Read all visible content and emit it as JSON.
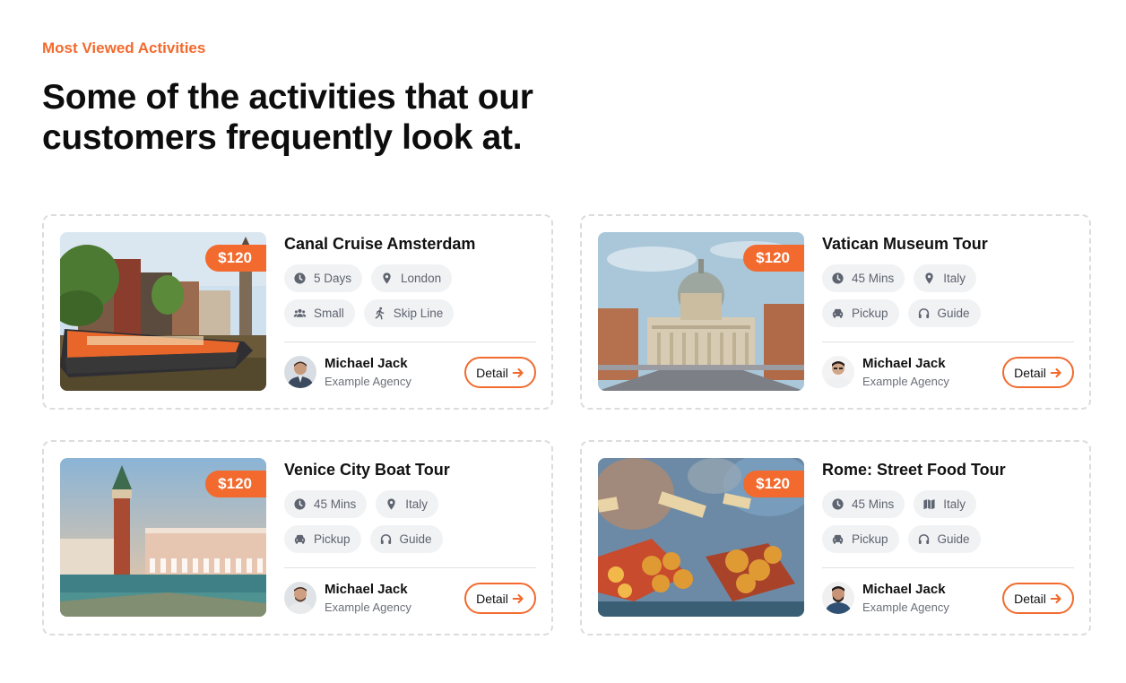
{
  "section": {
    "eyebrow": "Most Viewed Activities",
    "headline": "Some of the activities that our customers frequently look at."
  },
  "accent_color": "#f26a2e",
  "cards": [
    {
      "title": "Canal Cruise Amsterdam",
      "price": "$120",
      "chips": [
        {
          "icon": "clock-icon",
          "label": "5 Days"
        },
        {
          "icon": "location-pin-icon",
          "label": "London"
        },
        {
          "icon": "group-icon",
          "label": "Small"
        },
        {
          "icon": "walking-person-icon",
          "label": "Skip Line"
        }
      ],
      "agent": {
        "name": "Michael Jack",
        "agency": "Example Agency"
      },
      "detail_label": "Detail"
    },
    {
      "title": "Vatican Museum Tour",
      "price": "$120",
      "chips": [
        {
          "icon": "clock-icon",
          "label": "45 Mins"
        },
        {
          "icon": "location-pin-icon",
          "label": "Italy"
        },
        {
          "icon": "car-icon",
          "label": "Pickup"
        },
        {
          "icon": "headphones-icon",
          "label": "Guide"
        }
      ],
      "agent": {
        "name": "Michael Jack",
        "agency": "Example Agency"
      },
      "detail_label": "Detail"
    },
    {
      "title": "Venice City Boat Tour",
      "price": "$120",
      "chips": [
        {
          "icon": "clock-icon",
          "label": "45 Mins"
        },
        {
          "icon": "location-pin-icon",
          "label": "Italy"
        },
        {
          "icon": "car-icon",
          "label": "Pickup"
        },
        {
          "icon": "headphones-icon",
          "label": "Guide"
        }
      ],
      "agent": {
        "name": "Michael Jack",
        "agency": "Example Agency"
      },
      "detail_label": "Detail"
    },
    {
      "title": "Rome: Street Food Tour",
      "price": "$120",
      "chips": [
        {
          "icon": "clock-icon",
          "label": "45 Mins"
        },
        {
          "icon": "map-icon",
          "label": "Italy"
        },
        {
          "icon": "car-icon",
          "label": "Pickup"
        },
        {
          "icon": "headphones-icon",
          "label": "Guide"
        }
      ],
      "agent": {
        "name": "Michael Jack",
        "agency": "Example Agency"
      },
      "detail_label": "Detail"
    }
  ]
}
